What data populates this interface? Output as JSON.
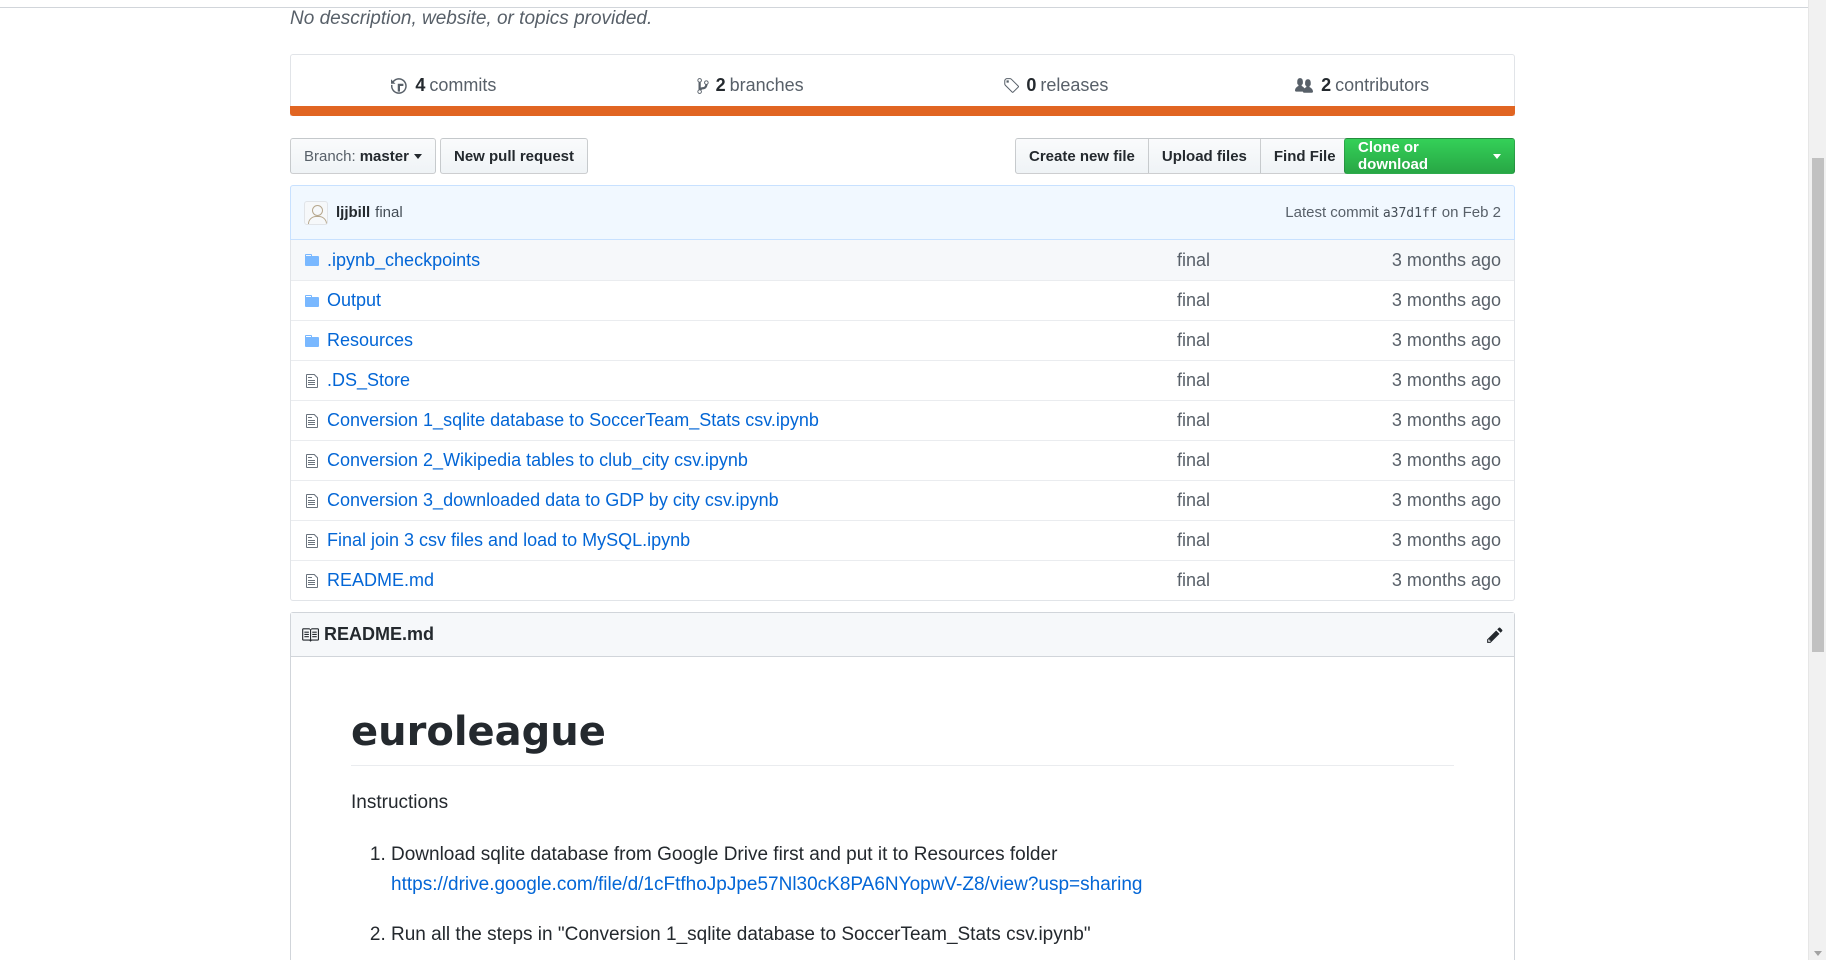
{
  "repo": {
    "description": "No description, website, or topics provided."
  },
  "summary": {
    "commits": {
      "count": "4",
      "label": "commits"
    },
    "branches": {
      "count": "2",
      "label": "branches"
    },
    "releases": {
      "count": "0",
      "label": "releases"
    },
    "contributors": {
      "count": "2",
      "label": "contributors"
    },
    "language_color": "#e16522"
  },
  "nav": {
    "branch_prefix": "Branch:",
    "branch_name": "master",
    "new_pull_request": "New pull request",
    "create_new_file": "Create new file",
    "upload_files": "Upload files",
    "find_file": "Find File",
    "clone_or_download": "Clone or download"
  },
  "commit": {
    "author": "ljjbill",
    "message": "final",
    "latest_prefix": "Latest commit",
    "sha": "a37d1ff",
    "date": "on Feb 2"
  },
  "files": [
    {
      "type": "dir",
      "icon": "folder-icon",
      "name": ".ipynb_checkpoints",
      "message": "final",
      "age": "3 months ago"
    },
    {
      "type": "dir",
      "icon": "folder-icon",
      "name": "Output",
      "message": "final",
      "age": "3 months ago"
    },
    {
      "type": "dir",
      "icon": "folder-icon",
      "name": "Resources",
      "message": "final",
      "age": "3 months ago"
    },
    {
      "type": "file",
      "icon": "file-icon",
      "name": ".DS_Store",
      "message": "final",
      "age": "3 months ago"
    },
    {
      "type": "file",
      "icon": "file-icon",
      "name": "Conversion 1_sqlite database to SoccerTeam_Stats csv.ipynb",
      "message": "final",
      "age": "3 months ago"
    },
    {
      "type": "file",
      "icon": "file-icon",
      "name": "Conversion 2_Wikipedia tables to club_city csv.ipynb",
      "message": "final",
      "age": "3 months ago"
    },
    {
      "type": "file",
      "icon": "file-icon",
      "name": "Conversion 3_downloaded data to GDP by city csv.ipynb",
      "message": "final",
      "age": "3 months ago"
    },
    {
      "type": "file",
      "icon": "file-icon",
      "name": "Final join 3 csv files and load to MySQL.ipynb",
      "message": "final",
      "age": "3 months ago"
    },
    {
      "type": "file",
      "icon": "file-icon",
      "name": "README.md",
      "message": "final",
      "age": "3 months ago"
    }
  ],
  "readme": {
    "filename": "README.md",
    "title": "euroleague",
    "intro": "Instructions",
    "steps": [
      {
        "text": "Download sqlite database from Google Drive first and put it to Resources folder",
        "link": "https://drive.google.com/file/d/1cFtfhoJpJpe57Nl30cK8PA6NYopwV-Z8/view?usp=sharing"
      },
      {
        "text": "Run all the steps in \"Conversion 1_sqlite database to SoccerTeam_Stats csv.ipynb\"",
        "link": ""
      }
    ]
  }
}
